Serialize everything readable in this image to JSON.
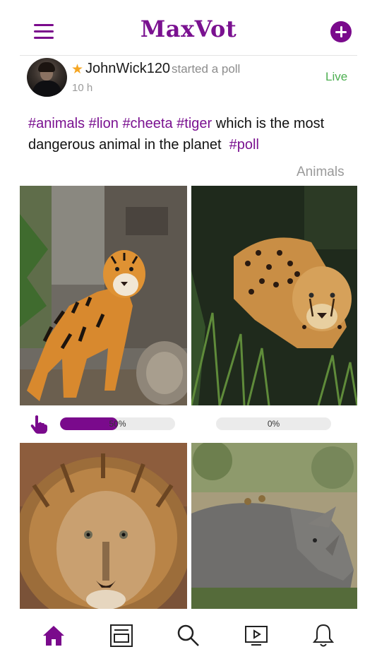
{
  "header": {
    "title": "MaxVot",
    "menu_icon": "hamburger-menu-icon",
    "add_icon": "plus-circle-icon",
    "accent_color": "#7a0a8c"
  },
  "post": {
    "author": {
      "username": "JohnWick120",
      "badge_icon": "star-icon",
      "badge_color": "#f5a623"
    },
    "action": "started a poll",
    "time": "10 h",
    "status": "Live",
    "status_color": "#4caf50",
    "text": {
      "tags": [
        "#animals",
        "#lion",
        "#cheeta",
        "#tiger"
      ],
      "body": "which is the most dangerous animal in the planet",
      "trailing_tag": "#poll"
    },
    "category": "Animals",
    "options": [
      {
        "image": "tiger photo",
        "percent": 50,
        "percent_label": "50%",
        "voted": true
      },
      {
        "image": "cheetah photo",
        "percent": 0,
        "percent_label": "0%",
        "voted": false
      },
      {
        "image": "lion photo"
      },
      {
        "image": "rhinoceros photo"
      }
    ]
  },
  "bottom_nav": {
    "items": [
      {
        "icon": "home-icon",
        "active": true
      },
      {
        "icon": "feed-icon",
        "active": false
      },
      {
        "icon": "search-icon",
        "active": false
      },
      {
        "icon": "video-icon",
        "active": false
      },
      {
        "icon": "bell-icon",
        "active": false
      }
    ]
  }
}
